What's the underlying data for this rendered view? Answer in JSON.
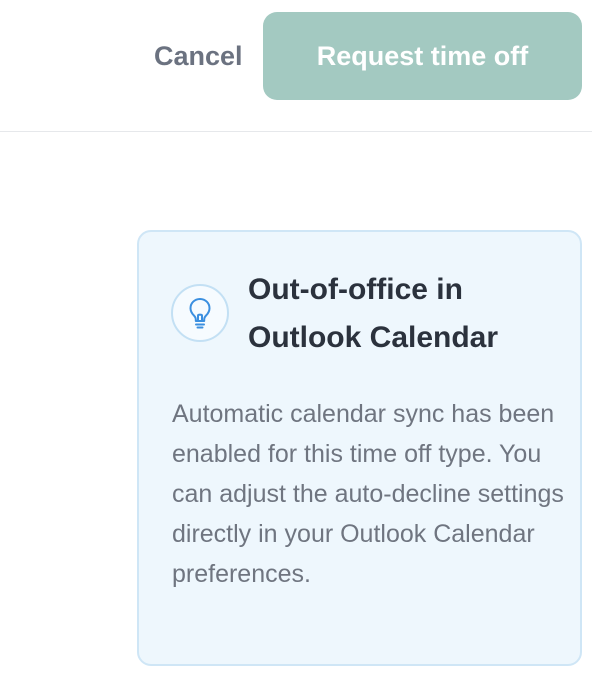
{
  "header": {
    "cancel_label": "Cancel",
    "submit_label": "Request time off"
  },
  "info_card": {
    "icon": "lightbulb-icon",
    "title": "Out-of-office in Outlook Calendar",
    "body": "Automatic calendar sync has been enabled for this time off type. You can adjust the auto-decline settings directly in your Outlook Calendar preferences."
  },
  "colors": {
    "primary_button": "#a3c9c1",
    "card_background": "#eef7fd",
    "card_border": "#cfe6f6",
    "icon_accent": "#3b8fe0"
  }
}
